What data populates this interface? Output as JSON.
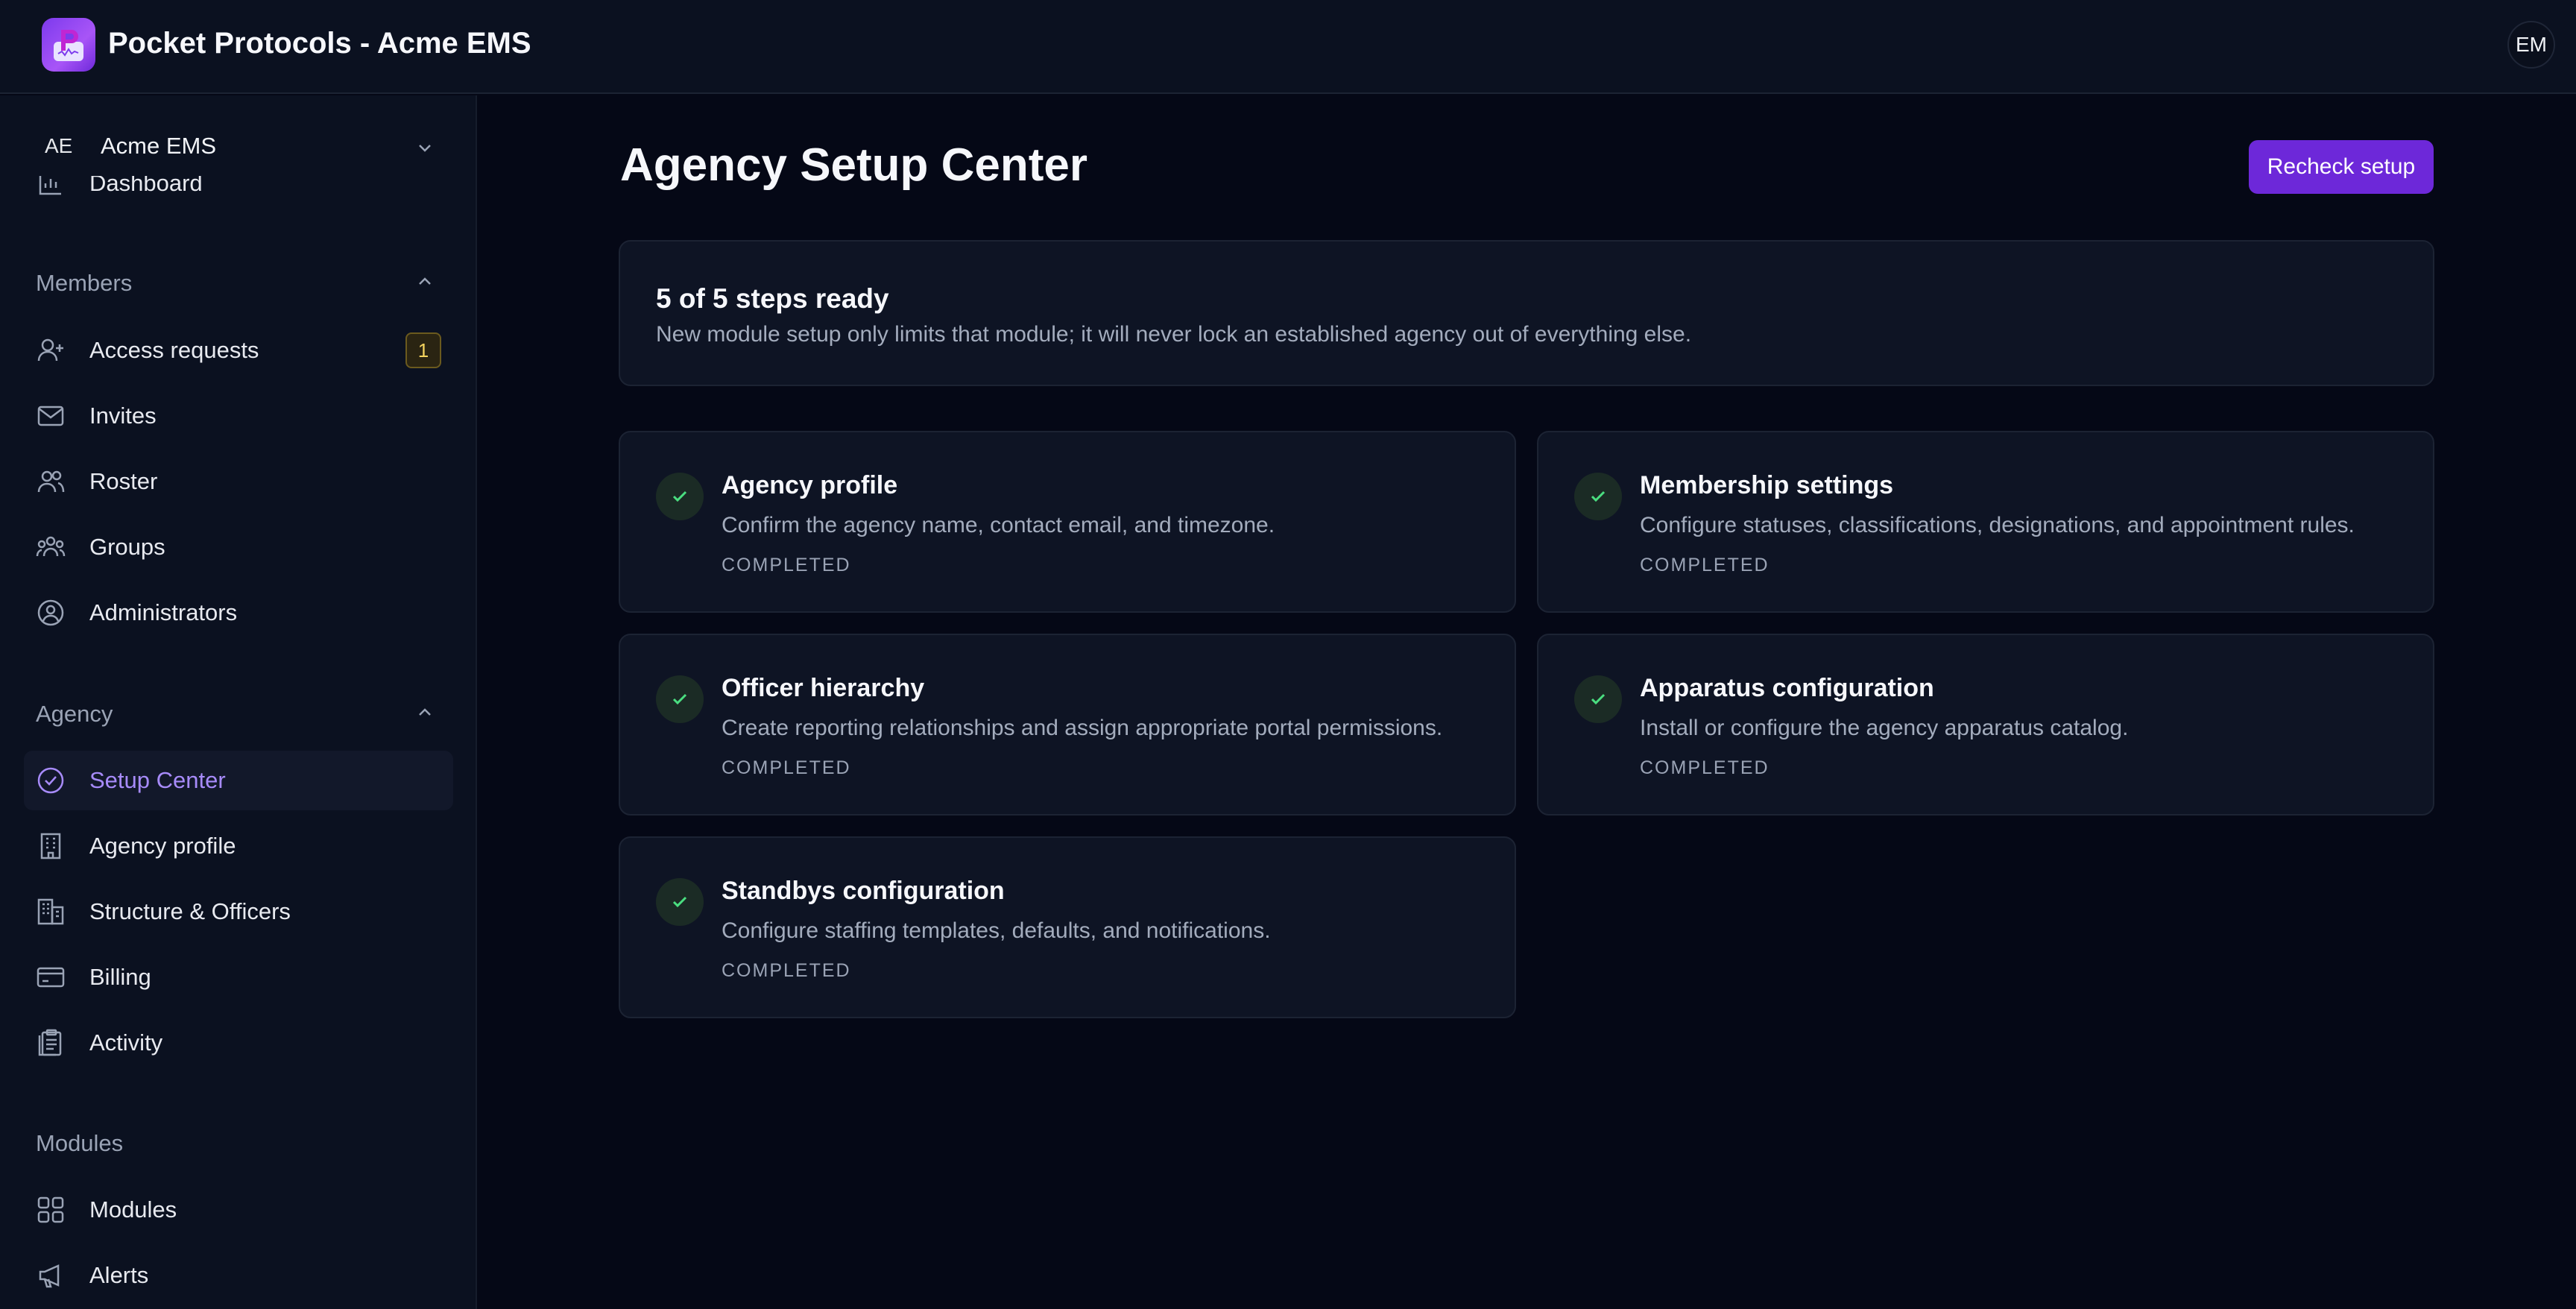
{
  "app": {
    "title": "Pocket Protocols - Acme EMS",
    "user_initials": "EM"
  },
  "sidebar": {
    "agency_switcher": {
      "initials": "AE",
      "name": "Acme EMS"
    },
    "partial_item": {
      "label": "Dashboard",
      "icon": "chart-icon"
    },
    "sections": {
      "members": {
        "title": "Members",
        "items": [
          {
            "label": "Access requests",
            "icon": "user-plus-icon",
            "badge": "1"
          },
          {
            "label": "Invites",
            "icon": "mail-icon"
          },
          {
            "label": "Roster",
            "icon": "users-icon"
          },
          {
            "label": "Groups",
            "icon": "group-icon"
          },
          {
            "label": "Administrators",
            "icon": "user-circle-icon"
          }
        ]
      },
      "agency": {
        "title": "Agency",
        "items": [
          {
            "label": "Setup Center",
            "icon": "check-circle-icon",
            "active": true
          },
          {
            "label": "Agency profile",
            "icon": "building-icon"
          },
          {
            "label": "Structure & Officers",
            "icon": "buildings-icon"
          },
          {
            "label": "Billing",
            "icon": "credit-card-icon"
          },
          {
            "label": "Activity",
            "icon": "clipboard-icon"
          }
        ]
      },
      "modules": {
        "title": "Modules",
        "items": [
          {
            "label": "Modules",
            "icon": "grid-icon"
          },
          {
            "label": "Alerts",
            "icon": "megaphone-icon"
          }
        ]
      }
    }
  },
  "main": {
    "title": "Agency Setup Center",
    "recheck_label": "Recheck setup",
    "summary": {
      "title": "5 of 5 steps ready",
      "description": "New module setup only limits that module; it will never lock an established agency out of everything else."
    },
    "steps": [
      {
        "title": "Agency profile",
        "description": "Confirm the agency name, contact email, and timezone.",
        "status": "COMPLETED"
      },
      {
        "title": "Membership settings",
        "description": "Configure statuses, classifications, designations, and appointment rules.",
        "status": "COMPLETED"
      },
      {
        "title": "Officer hierarchy",
        "description": "Create reporting relationships and assign appropriate portal permissions.",
        "status": "COMPLETED"
      },
      {
        "title": "Apparatus configuration",
        "description": "Install or configure the agency apparatus catalog.",
        "status": "COMPLETED"
      },
      {
        "title": "Standbys configuration",
        "description": "Configure staffing templates, defaults, and notifications.",
        "status": "COMPLETED"
      }
    ]
  },
  "colors": {
    "accent": "#6d28d9",
    "active_text": "#a78bfa",
    "success": "#4ade80",
    "badge": "#f4d35e"
  }
}
